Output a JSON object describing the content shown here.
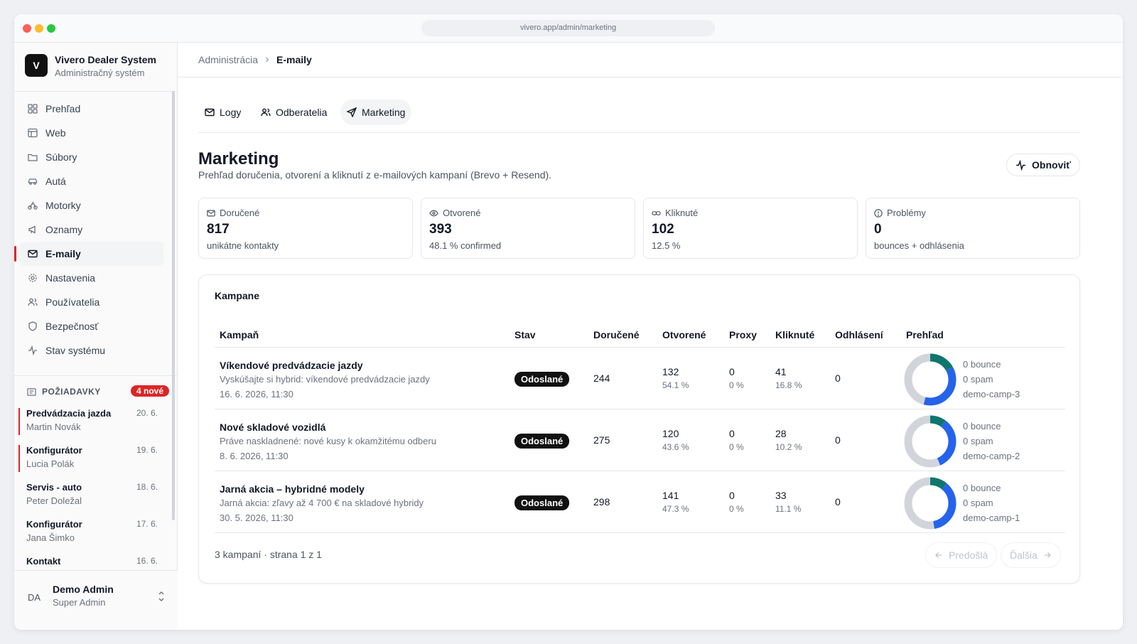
{
  "browser": {
    "url": "vivero.app/admin/marketing"
  },
  "brand": {
    "logo_letter": "V",
    "title": "Vivero Dealer System",
    "subtitle": "Administračný systém"
  },
  "nav": [
    {
      "label": "Prehľad",
      "icon": "grid-icon"
    },
    {
      "label": "Web",
      "icon": "layout-icon"
    },
    {
      "label": "Súbory",
      "icon": "folder-icon"
    },
    {
      "label": "Autá",
      "icon": "car-icon"
    },
    {
      "label": "Motorky",
      "icon": "bike-icon"
    },
    {
      "label": "Oznamy",
      "icon": "megaphone-icon"
    },
    {
      "label": "E-maily",
      "icon": "mail-icon",
      "active": true
    },
    {
      "label": "Nastavenia",
      "icon": "gear-icon"
    },
    {
      "label": "Používatelia",
      "icon": "users-icon"
    },
    {
      "label": "Bezpečnosť",
      "icon": "shield-icon"
    },
    {
      "label": "Stav systému",
      "icon": "activity-icon"
    }
  ],
  "requests": {
    "header": "POŽIADAVKY",
    "badge": "4 nové",
    "items": [
      {
        "title": "Predvádzacia jazda",
        "name": "Martin Novák",
        "date": "20. 6.",
        "urgent": true
      },
      {
        "title": "Konfigurátor",
        "name": "Lucia Polák",
        "date": "19. 6.",
        "urgent": true
      },
      {
        "title": "Servis - auto",
        "name": "Peter Doležal",
        "date": "18. 6.",
        "urgent": false
      },
      {
        "title": "Konfigurátor",
        "name": "Jana Šimko",
        "date": "17. 6.",
        "urgent": false
      },
      {
        "title": "Kontakt",
        "name": "",
        "date": "16. 6.",
        "urgent": false
      }
    ]
  },
  "user": {
    "initials": "DA",
    "name": "Demo Admin",
    "role": "Super Admin"
  },
  "breadcrumb": {
    "parent": "Administrácia",
    "current": "E-maily"
  },
  "tabs": [
    {
      "label": "Logy",
      "icon": "mail-icon"
    },
    {
      "label": "Odberatelia",
      "icon": "users-icon"
    },
    {
      "label": "Marketing",
      "icon": "send-icon",
      "active": true
    }
  ],
  "page": {
    "title": "Marketing",
    "description": "Prehľad doručenia, otvorení a kliknutí z e-mailových kampaní (Brevo + Resend).",
    "refresh_label": "Obnoviť"
  },
  "stats": [
    {
      "label": "Doručené",
      "icon": "mail-icon",
      "value": "817",
      "sub": "unikátne kontakty"
    },
    {
      "label": "Otvorené",
      "icon": "eye-icon",
      "value": "393",
      "sub": "48.1 % confirmed"
    },
    {
      "label": "Kliknuté",
      "icon": "link-icon",
      "value": "102",
      "sub": "12.5 %"
    },
    {
      "label": "Problémy",
      "icon": "alert-circle-icon",
      "value": "0",
      "sub": "bounces + odhlásenia"
    }
  ],
  "campaigns": {
    "title": "Kampane",
    "columns": [
      "Kampaň",
      "Stav",
      "Doručené",
      "Otvorené",
      "Proxy",
      "Kliknuté",
      "Odhlásení",
      "Prehľad"
    ],
    "rows": [
      {
        "name": "Víkendové predvádzacie jazdy",
        "subject": "Vyskúšajte si hybrid: víkendové predvádzacie jazdy",
        "date": "16. 6. 2026, 11:30",
        "status": "Odoslané",
        "delivered": "244",
        "opened": "132",
        "opened_pct": "54.1 %",
        "proxy": "0",
        "proxy_pct": "0 %",
        "clicked": "41",
        "clicked_pct": "16.8 %",
        "unsubscribed": "0",
        "bounce": "0 bounce",
        "spam": "0 spam",
        "tag": "demo-camp-3",
        "donut": {
          "delivered": 244,
          "opened": 132,
          "clicked": 41
        }
      },
      {
        "name": "Nové skladové vozidlá",
        "subject": "Práve naskladnené: nové kusy k okamžitému odberu",
        "date": "8. 6. 2026, 11:30",
        "status": "Odoslané",
        "delivered": "275",
        "opened": "120",
        "opened_pct": "43.6 %",
        "proxy": "0",
        "proxy_pct": "0 %",
        "clicked": "28",
        "clicked_pct": "10.2 %",
        "unsubscribed": "0",
        "bounce": "0 bounce",
        "spam": "0 spam",
        "tag": "demo-camp-2",
        "donut": {
          "delivered": 275,
          "opened": 120,
          "clicked": 28
        }
      },
      {
        "name": "Jarná akcia – hybridné modely",
        "subject": "Jarná akcia: zľavy až 4 700 € na skladové hybridy",
        "date": "30. 5. 2026, 11:30",
        "status": "Odoslané",
        "delivered": "298",
        "opened": "141",
        "opened_pct": "47.3 %",
        "proxy": "0",
        "proxy_pct": "0 %",
        "clicked": "33",
        "clicked_pct": "11.1 %",
        "unsubscribed": "0",
        "bounce": "0 bounce",
        "spam": "0 spam",
        "tag": "demo-camp-1",
        "donut": {
          "delivered": 298,
          "opened": 141,
          "clicked": 33
        }
      }
    ],
    "footer": "3 kampaní · strana 1 z 1",
    "prev_label": "Predošlá",
    "next_label": "Ďalšia"
  },
  "colors": {
    "accent_red": "#dc2626",
    "donut_blue": "#2563eb",
    "donut_green": "#0f766e",
    "donut_gray": "#d1d5db"
  }
}
